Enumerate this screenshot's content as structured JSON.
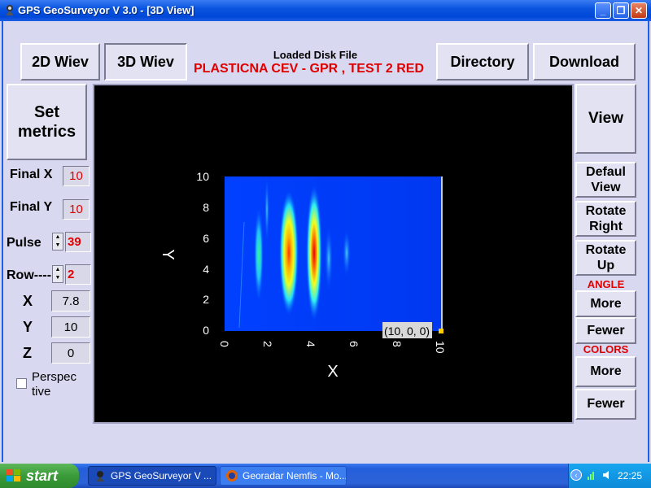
{
  "window": {
    "title": "GPS GeoSurveyor  V 3.0 - [3D View]",
    "buttons": {
      "minimize": "_",
      "restore": "❐",
      "close": "✕"
    }
  },
  "toolbar": {
    "view2d": "2D Wiev",
    "view3d": "3D Wiev",
    "loaded_label": "Loaded Disk File",
    "loaded_file": "PLASTICNA CEV - GPR  , TEST 2   RED",
    "directory": "Directory",
    "download": "Download"
  },
  "left": {
    "set_metrics": [
      "Set",
      "metrics"
    ],
    "final_x_label": "Final X",
    "final_x": "10",
    "final_y_label": "Final Y",
    "final_y": "10",
    "pulse_label": "Pulse",
    "pulse": "39",
    "row_label": "Row----",
    "row": "2",
    "x_label": "X",
    "x": "7.8",
    "y_label": "Y",
    "y": "10",
    "z_label": "Z",
    "z": "0",
    "perspective": [
      "Perspec",
      "tive"
    ]
  },
  "right": {
    "view": "View",
    "default_view": [
      "Defaul",
      "View"
    ],
    "rotate_right": [
      "Rotate",
      "Right"
    ],
    "rotate_up": [
      "Rotate",
      "Up"
    ],
    "angle_label": "ANGLE",
    "angle_more": "More",
    "angle_fewer": "Fewer",
    "colors_label": "COLORS",
    "colors_more": "More",
    "colors_fewer": "Fewer"
  },
  "plot": {
    "xlabel": "X",
    "ylabel": "Y",
    "xticks": [
      "0",
      "2",
      "4",
      "6",
      "8",
      "10"
    ],
    "yticks": [
      "0",
      "2",
      "4",
      "6",
      "8",
      "10"
    ],
    "cursor": "(10, 0, 0)"
  },
  "taskbar": {
    "start": "start",
    "task1": "GPS GeoSurveyor  V ...",
    "task2": "Georadar Nemfis - Mo...",
    "clock": "22:25"
  }
}
